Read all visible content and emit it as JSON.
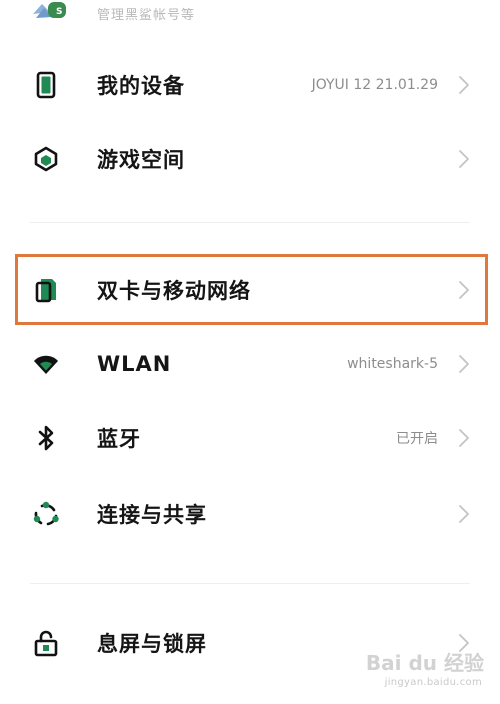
{
  "account": {
    "subtitle": "管理黑鲨帐号等"
  },
  "items": [
    {
      "label": "我的设备",
      "value": "JOYUI 12 21.01.29",
      "icon": "phone-device-icon"
    },
    {
      "label": "游戏空间",
      "value": "",
      "icon": "game-space-icon"
    },
    {
      "label": "双卡与移动网络",
      "value": "",
      "icon": "sim-card-icon"
    },
    {
      "label": "WLAN",
      "value": "whiteshark-5",
      "icon": "wifi-icon"
    },
    {
      "label": "蓝牙",
      "value": "已开启",
      "icon": "bluetooth-icon"
    },
    {
      "label": "连接与共享",
      "value": "",
      "icon": "share-icon"
    },
    {
      "label": "息屏与锁屏",
      "value": "",
      "icon": "lock-icon"
    }
  ],
  "colors": {
    "accent_green": "#1f8a54",
    "highlight_border": "#e0783e",
    "chevron": "#c4c4c4"
  },
  "watermark": {
    "logo": "Bai du 经验",
    "url": "jingyan.baidu.com"
  }
}
